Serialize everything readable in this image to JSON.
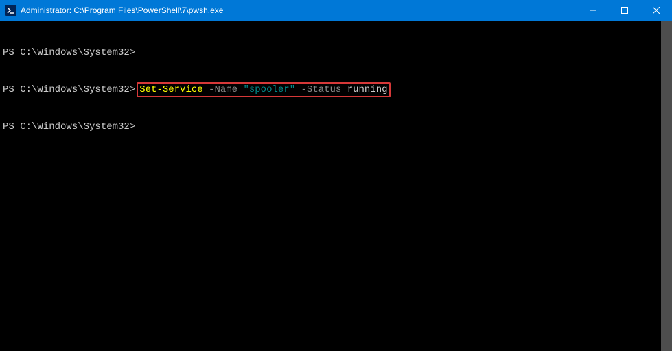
{
  "titlebar": {
    "title": "Administrator: C:\\Program Files\\PowerShell\\7\\pwsh.exe"
  },
  "terminal": {
    "lines": [
      {
        "prompt": "PS C:\\Windows\\System32>",
        "command": ""
      },
      {
        "prompt": "PS C:\\Windows\\System32>",
        "command_highlighted": true,
        "segment1": "Set-Service",
        "segment2": " -Name",
        "segment3": " \"spooler\"",
        "segment4": " -Status",
        "segment5": " running"
      },
      {
        "prompt": "PS C:\\Windows\\System32>",
        "command": ""
      }
    ]
  }
}
